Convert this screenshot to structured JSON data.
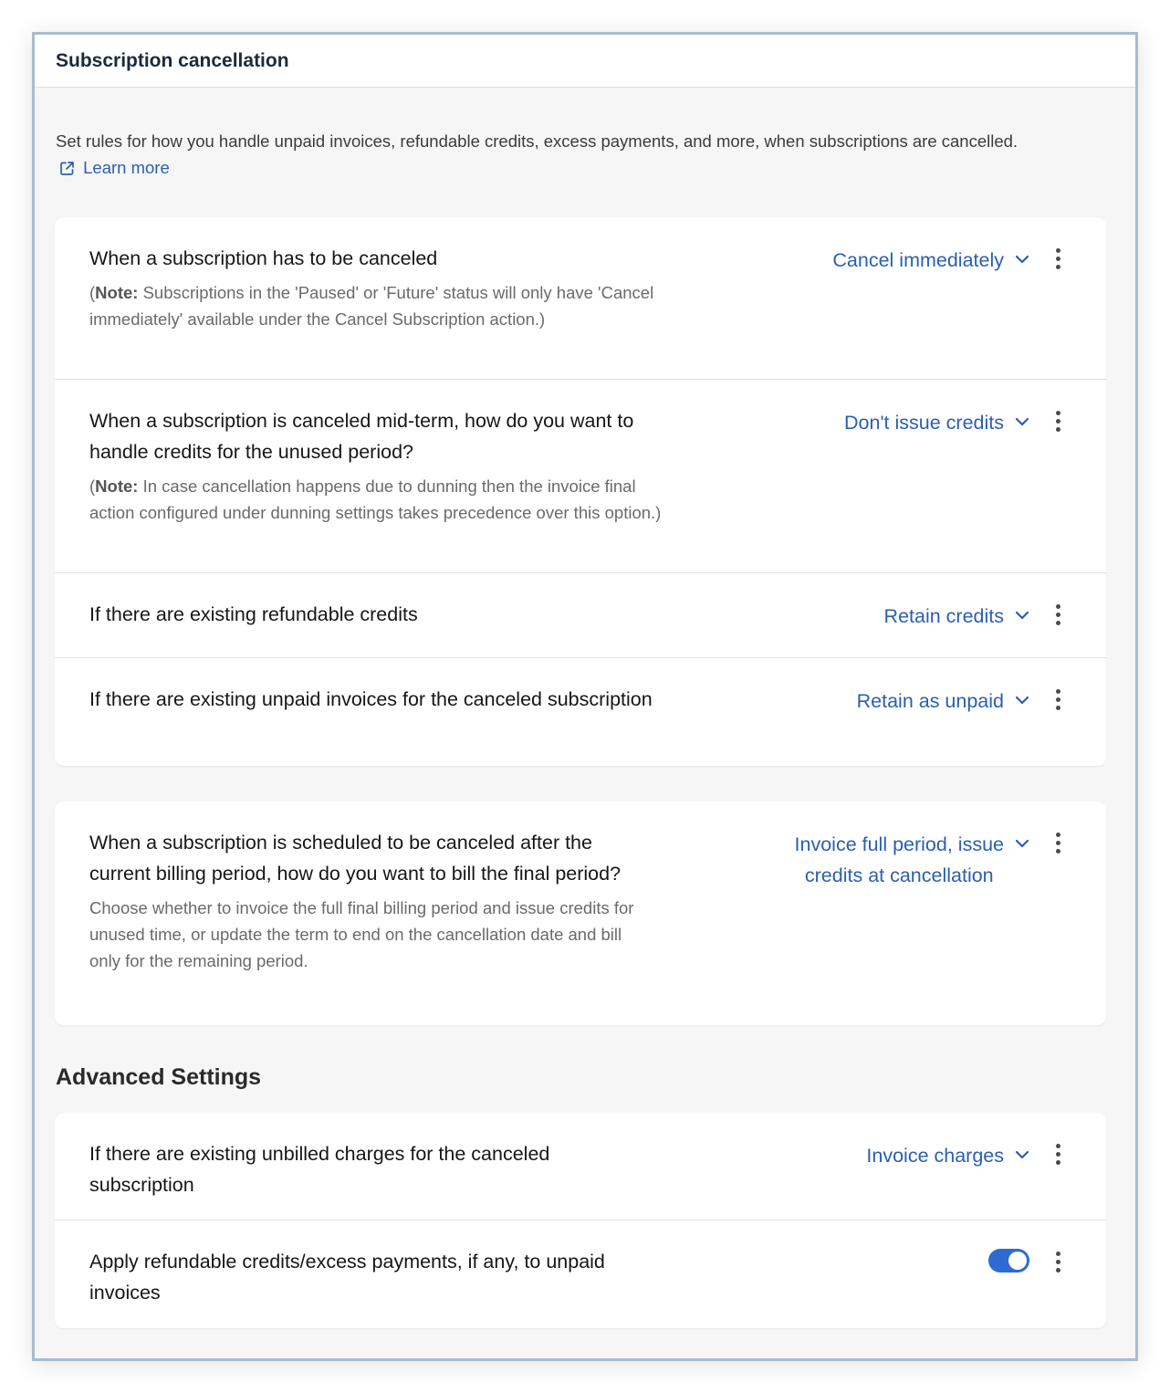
{
  "header": {
    "title": "Subscription cancellation"
  },
  "intro": {
    "text": "Set rules for how you handle unpaid invoices, refundable credits, excess payments, and more, when subscriptions are cancelled.",
    "learn_more": "Learn more"
  },
  "card1": {
    "rows": [
      {
        "title": "When a subscription has to be canceled",
        "note_prefix": "(",
        "note_bold": "Note:",
        "note_text": " Subscriptions in the 'Paused' or 'Future' status will only have 'Cancel immediately' available under the Cancel Subscription action.)",
        "value": "Cancel immediately"
      },
      {
        "title": "When a subscription is canceled mid-term, how do you want to handle credits for the unused period?",
        "note_prefix": "(",
        "note_bold": "Note:",
        "note_text": " In case cancellation happens due to dunning then the invoice final action configured under dunning settings takes precedence over this option.)",
        "value": "Don't issue credits"
      },
      {
        "title": "If there are existing refundable credits",
        "value": "Retain credits"
      },
      {
        "title": "If there are existing unpaid invoices for the canceled subscription",
        "value": "Retain as unpaid"
      }
    ]
  },
  "card2": {
    "rows": [
      {
        "title": "When a subscription is scheduled to be canceled after the current billing period, how do you want to bill the final period?",
        "note": "Choose whether to invoice the full final billing period and issue credits for unused time, or update the term to end on the cancellation date and bill only for the remaining period.",
        "value_line1": "Invoice full period, issue",
        "value_line2": "credits at cancellation"
      }
    ]
  },
  "advanced": {
    "title": "Advanced Settings",
    "rows": [
      {
        "title": "If there are existing unbilled charges for the canceled subscription",
        "value": "Invoice charges"
      },
      {
        "title": "Apply refundable credits/excess payments, if any, to unpaid invoices",
        "toggle_on": true
      }
    ]
  },
  "colors": {
    "accent": "#2a5fb0",
    "toggle": "#2f6ad3",
    "frame_border": "#a9bccb"
  },
  "icons": {
    "external_link": "external-link-icon",
    "chevron": "chevron-down-icon",
    "kebab": "kebab-menu-icon"
  }
}
